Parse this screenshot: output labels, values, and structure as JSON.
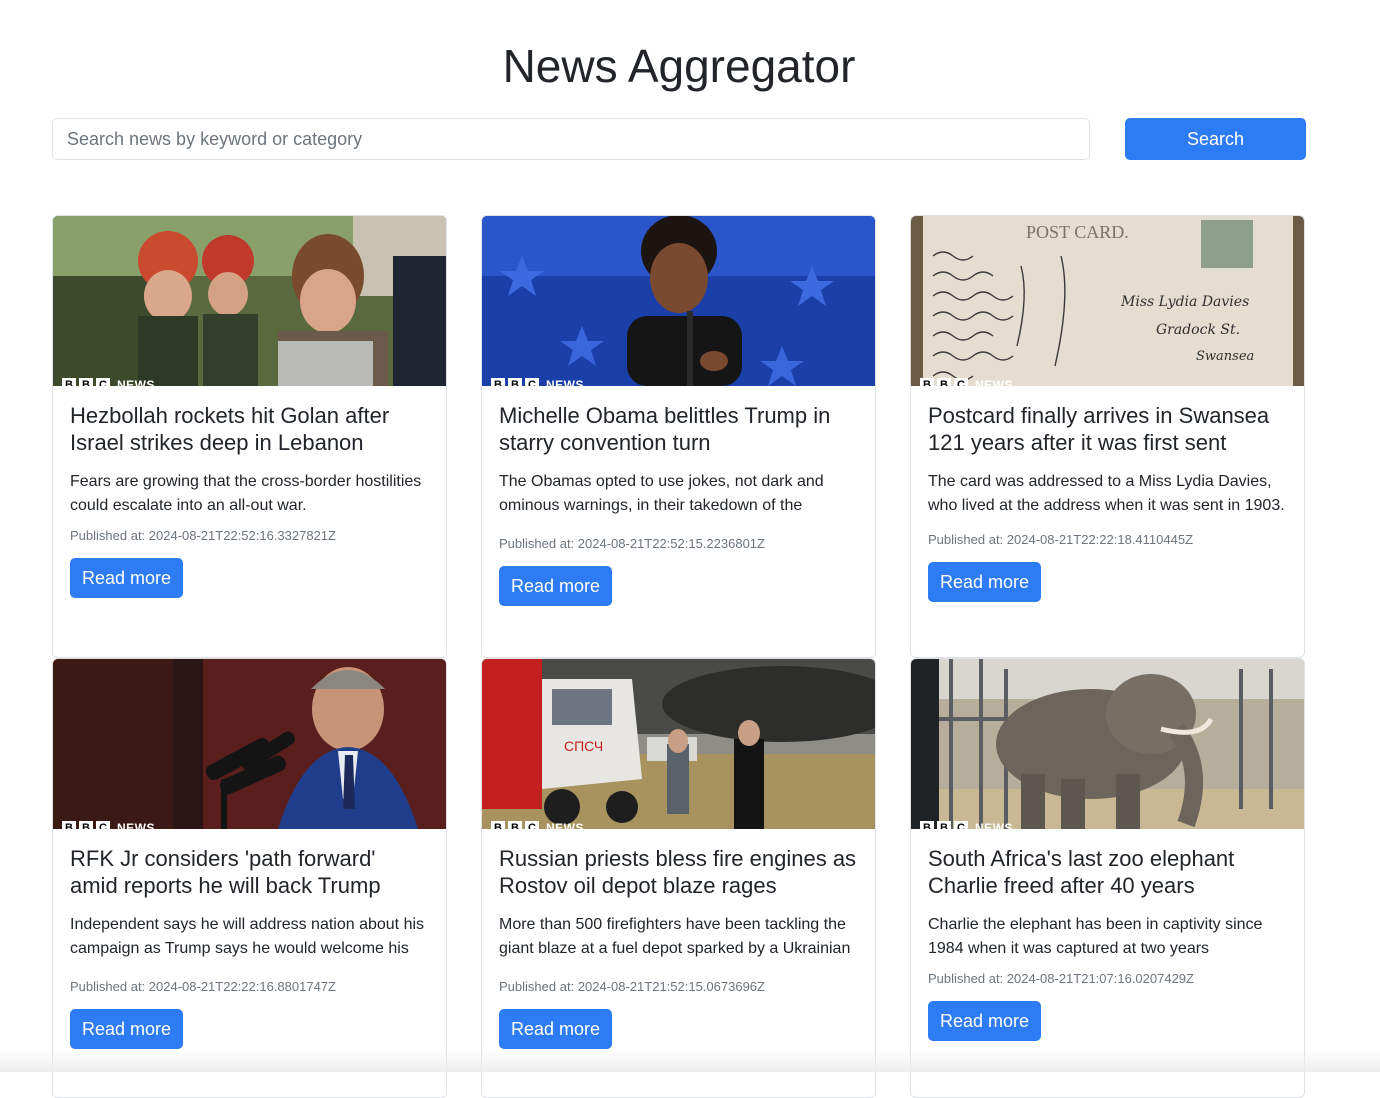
{
  "header": {
    "title": "News Aggregator"
  },
  "search": {
    "placeholder": "Search news by keyword or category",
    "value": "",
    "button_label": "Search"
  },
  "image_logo": {
    "letters": [
      "B",
      "B",
      "C"
    ],
    "word": "NEWS"
  },
  "articles": [
    {
      "title": "Hezbollah rockets hit Golan after Israel strikes deep in Lebanon",
      "description": "Fears are growing that the cross-border hostilities could escalate into an all-out war.",
      "published": "Published at: 2024-08-21T22:52:16.3327821Z",
      "button_label": "Read more",
      "image_icon": "rescue-workers-photo"
    },
    {
      "title": "Michelle Obama belittles Trump in starry convention turn",
      "description": "The Obamas opted to use jokes, not dark and ominous warnings, in their takedown of the Republican candidate.",
      "published": "Published at: 2024-08-21T22:52:15.2236801Z",
      "button_label": "Read more",
      "image_icon": "speaker-photo"
    },
    {
      "title": "Postcard finally arrives in Swansea 121 years after it was first sent",
      "description": "The card was addressed to a Miss Lydia Davies, who lived at the address when it was sent in 1903.",
      "published": "Published at: 2024-08-21T22:22:18.4110445Z",
      "button_label": "Read more",
      "image_icon": "postcard-photo"
    },
    {
      "title": "RFK Jr considers 'path forward' amid reports he will back Trump",
      "description": "Independent says he will address nation about his campaign as Trump says he would welcome his support.",
      "published": "Published at: 2024-08-21T22:22:16.8801747Z",
      "button_label": "Read more",
      "image_icon": "podium-speaker-photo"
    },
    {
      "title": "Russian priests bless fire engines as Rostov oil depot blaze rages",
      "description": "More than 500 firefighters have been tackling the giant blaze at a fuel depot sparked by a Ukrainian attack.",
      "published": "Published at: 2024-08-21T21:52:15.0673696Z",
      "button_label": "Read more",
      "image_icon": "fire-engine-photo"
    },
    {
      "title": "South Africa's last zoo elephant Charlie freed after 40 years",
      "description": "Charlie the elephant has been in captivity since 1984 when it was captured at two years",
      "published": "Published at: 2024-08-21T21:07:16.0207429Z",
      "button_label": "Read more",
      "image_icon": "elephant-photo"
    }
  ],
  "colors": {
    "primary": "#2d7cf6",
    "text": "#212529",
    "muted": "#6c757d",
    "border": "#dee2e6"
  }
}
